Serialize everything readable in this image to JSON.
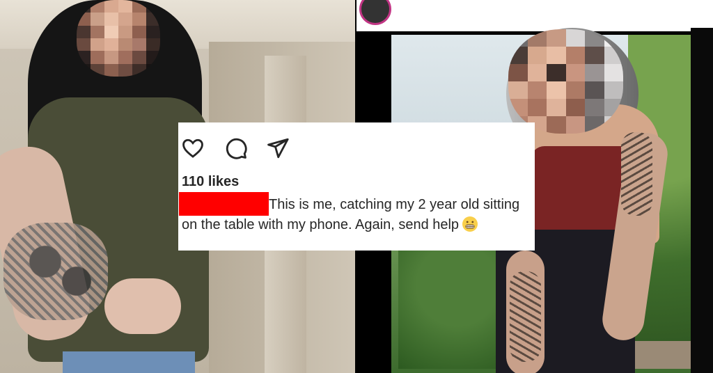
{
  "post": {
    "likes": "110 likes",
    "caption": "This is me, catching my 2 year old sitting on the table with my phone. Again, send help",
    "emoji_name": "grimacing-face-emoji"
  },
  "icons": {
    "like": "heart-icon",
    "comment": "comment-icon",
    "share": "paper-plane-icon"
  },
  "colors": {
    "redaction": "#ff0000",
    "text": "#262626"
  }
}
